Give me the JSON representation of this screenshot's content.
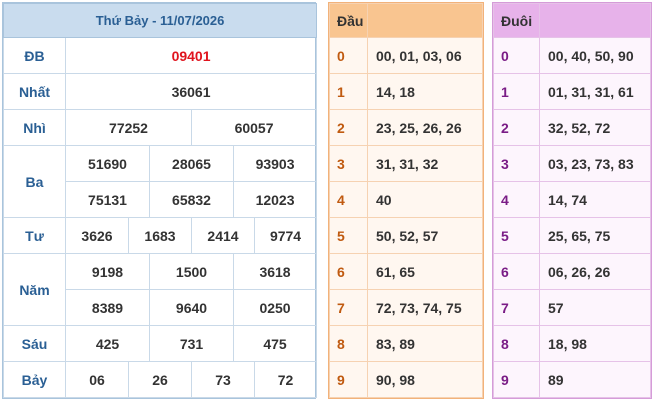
{
  "results": {
    "date_header": "Thứ Bảy - 11/07/2026",
    "rows": [
      {
        "label": "ĐB",
        "numbers": [
          "09401"
        ]
      },
      {
        "label": "Nhất",
        "numbers": [
          "36061"
        ]
      },
      {
        "label": "Nhì",
        "numbers": [
          "77252",
          "60057"
        ]
      },
      {
        "label": "Ba",
        "numbers": [
          "51690",
          "28065",
          "93903",
          "75131",
          "65832",
          "12023"
        ]
      },
      {
        "label": "Tư",
        "numbers": [
          "3626",
          "1683",
          "2414",
          "9774"
        ]
      },
      {
        "label": "Năm",
        "numbers": [
          "9198",
          "1500",
          "3618",
          "8389",
          "9640",
          "0250"
        ]
      },
      {
        "label": "Sáu",
        "numbers": [
          "425",
          "731",
          "475"
        ]
      },
      {
        "label": "Bảy",
        "numbers": [
          "06",
          "26",
          "73",
          "72"
        ]
      }
    ],
    "special_color": "#e0141e"
  },
  "dau": {
    "header": "Đầu",
    "rows": [
      {
        "k": "0",
        "v": "00, 01, 03, 06"
      },
      {
        "k": "1",
        "v": "14, 18"
      },
      {
        "k": "2",
        "v": "23, 25, 26, 26"
      },
      {
        "k": "3",
        "v": "31, 31, 32"
      },
      {
        "k": "4",
        "v": "40"
      },
      {
        "k": "5",
        "v": "50, 52, 57"
      },
      {
        "k": "6",
        "v": "61, 65"
      },
      {
        "k": "7",
        "v": "72, 73, 74, 75"
      },
      {
        "k": "8",
        "v": "83, 89"
      },
      {
        "k": "9",
        "v": "90, 98"
      }
    ]
  },
  "duoi": {
    "header": "Đuôi",
    "rows": [
      {
        "k": "0",
        "v": "00, 40, 50, 90"
      },
      {
        "k": "1",
        "v": "01, 31, 31, 61"
      },
      {
        "k": "2",
        "v": "32, 52, 72"
      },
      {
        "k": "3",
        "v": "03, 23, 73, 83"
      },
      {
        "k": "4",
        "v": "14, 74"
      },
      {
        "k": "5",
        "v": "25, 65, 75"
      },
      {
        "k": "6",
        "v": "06, 26, 26"
      },
      {
        "k": "7",
        "v": "57"
      },
      {
        "k": "8",
        "v": "18, 98"
      },
      {
        "k": "9",
        "v": "89"
      }
    ]
  }
}
